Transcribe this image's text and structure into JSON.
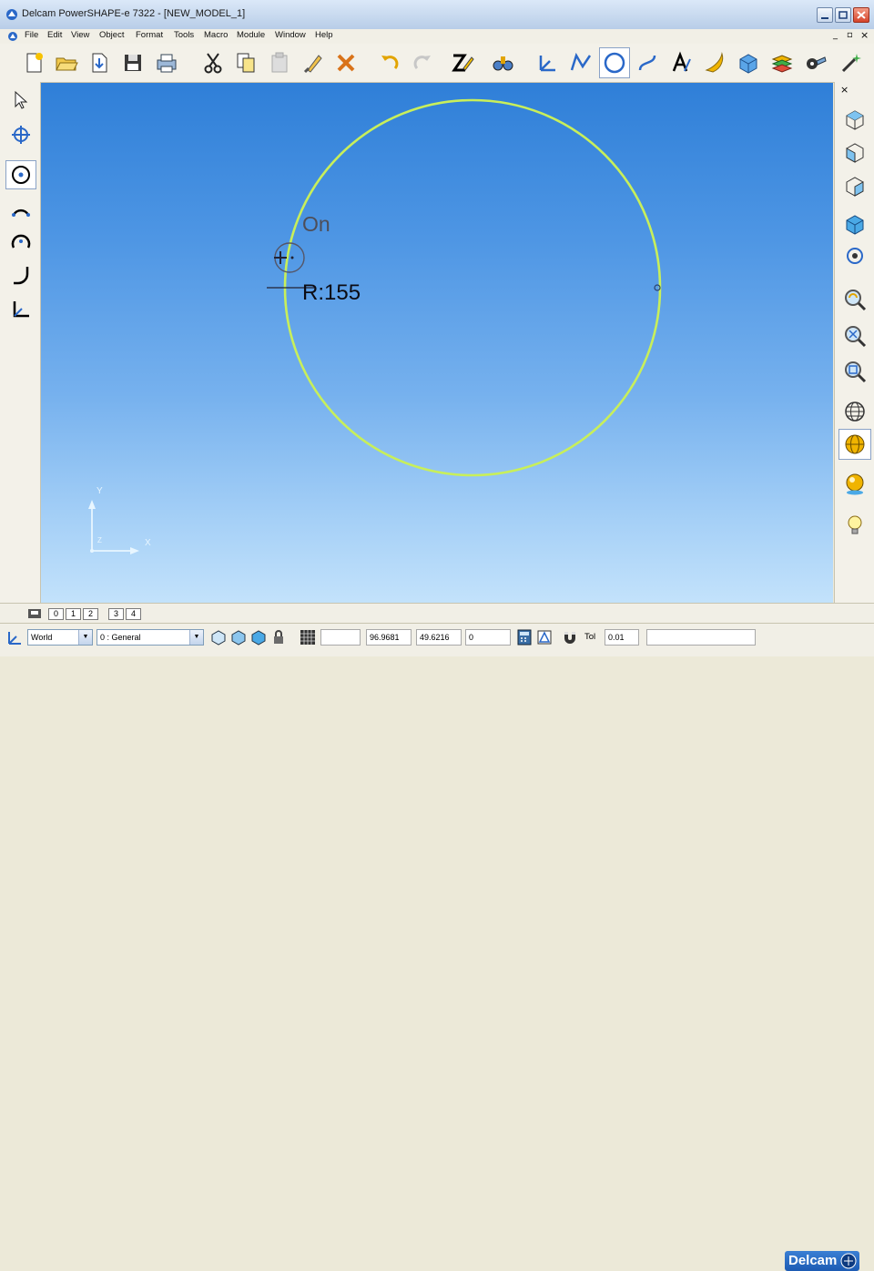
{
  "window": {
    "title": "Delcam PowerSHAPE-e 7322 - [NEW_MODEL_1]"
  },
  "menu": {
    "items": [
      "File",
      "Edit",
      "View",
      "Object",
      "Format",
      "Tools",
      "Macro",
      "Module",
      "Window",
      "Help"
    ]
  },
  "viewport": {
    "snap_label": "On",
    "radius_label": "R:155",
    "axes": {
      "x": "X",
      "y": "Y",
      "z": "Z"
    },
    "colors": {
      "circle": "#c8ef5a",
      "axis": "#e8f6ff"
    }
  },
  "levels": [
    "0",
    "1",
    "2",
    "3",
    "4"
  ],
  "status": {
    "workplane": "World",
    "level": "0 : General",
    "x": "96.9681",
    "y": "49.6216",
    "z": "0",
    "tol_label": "Tol",
    "tol": "0.01"
  },
  "brand": "Delcam"
}
